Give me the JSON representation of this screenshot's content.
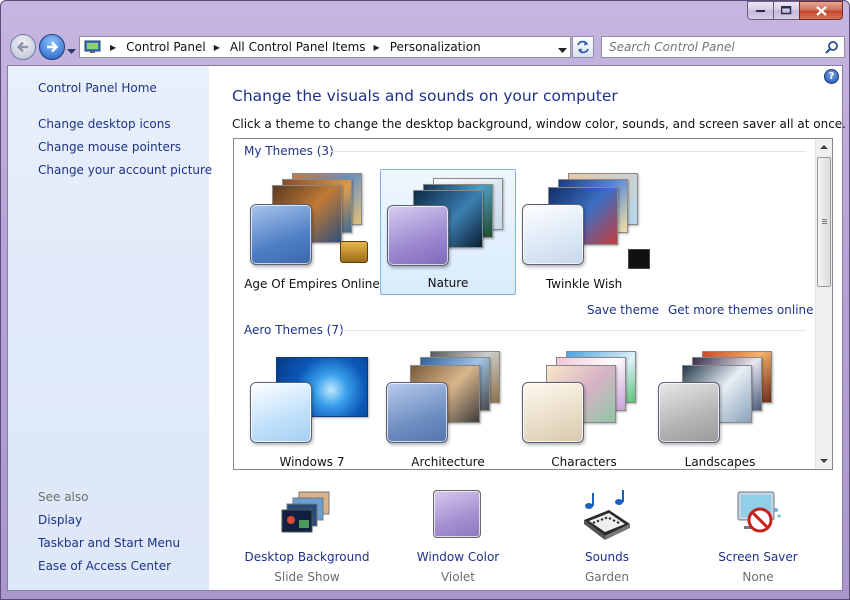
{
  "address": {
    "crumbs": [
      "Control Panel",
      "All Control Panel Items",
      "Personalization"
    ]
  },
  "search": {
    "placeholder": "Search Control Panel"
  },
  "sidebar": {
    "home": "Control Panel Home",
    "links": [
      "Change desktop icons",
      "Change mouse pointers",
      "Change your account picture"
    ],
    "see_also_title": "See also",
    "see_also": [
      "Display",
      "Taskbar and Start Menu",
      "Ease of Access Center"
    ]
  },
  "main": {
    "heading": "Change the visuals and sounds on your computer",
    "subtext": "Click a theme to change the desktop background, window color, sounds, and screen saver all at once."
  },
  "my_themes": {
    "title": "My Themes (3)",
    "items": [
      {
        "name": "Age Of Empires Online",
        "glass": "#5d8fd1"
      },
      {
        "name": "Nature",
        "glass": "#9b88cf",
        "selected": true
      },
      {
        "name": "Twinkle Wish",
        "glass": "#dbe8f5"
      }
    ],
    "save_theme": "Save theme",
    "get_more": "Get more themes online"
  },
  "aero_themes": {
    "title": "Aero Themes (7)",
    "items": [
      {
        "name": "Windows 7",
        "glass": "#bfe0fa"
      },
      {
        "name": "Architecture",
        "glass": "#6f8fc2"
      },
      {
        "name": "Characters",
        "glass": "#e8dcc6"
      },
      {
        "name": "Landscapes",
        "glass": "#b4b4b4"
      }
    ]
  },
  "bottom": [
    {
      "label": "Desktop Background",
      "value": "Slide Show",
      "icon": "desktop-background-icon"
    },
    {
      "label": "Window Color",
      "value": "Violet",
      "icon": "window-color-icon"
    },
    {
      "label": "Sounds",
      "value": "Garden",
      "icon": "sounds-icon"
    },
    {
      "label": "Screen Saver",
      "value": "None",
      "icon": "screen-saver-icon"
    }
  ],
  "colors": {
    "link": "#1e3287",
    "selected_fill": "#d8ebfc",
    "window_color": "#a58fd0",
    "frame": "#b7a3d6"
  }
}
